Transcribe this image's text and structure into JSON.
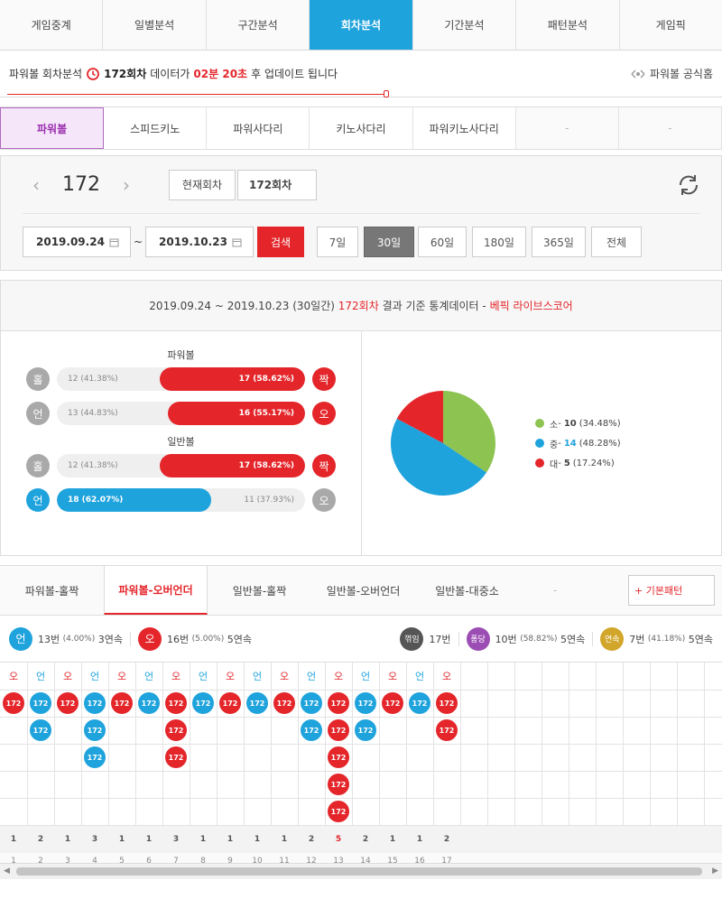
{
  "top_tabs": [
    "게임중계",
    "일별분석",
    "구간분석",
    "회차분석",
    "기간분석",
    "패턴분석",
    "게임픽"
  ],
  "info": {
    "prefix": "파워볼 회차분석",
    "round": "172회차",
    "mid": "데이터가",
    "countdown": "02분 20초",
    "suffix": "후 업데이트 됩니다",
    "official": "파워볼 공식홈"
  },
  "game_tabs": [
    "파워볼",
    "스피드키노",
    "파워사다리",
    "키노사다리",
    "파워키노사다리",
    "-",
    "-"
  ],
  "round_panel": {
    "round": "172",
    "current_btn": "현재회차",
    "round_input": "172회차",
    "date_from": "2019.09.24",
    "date_to": "2019.10.23",
    "tilde": "~",
    "search": "검색",
    "periods": [
      "7일",
      "30일",
      "60일",
      "180일",
      "365일",
      "전체"
    ]
  },
  "stats": {
    "head_range": "2019.09.24 ~ 2019.10.23 (30일간)",
    "head_round": "172회차",
    "head_text": "결과 기준 통계데이터 -",
    "head_brand": "베픽 라이브스코어",
    "powerball_title": "파워볼",
    "normal_title": "일반볼",
    "rows": [
      {
        "left_icon": "홀",
        "left_label": "12 (41.38%)",
        "right_label": "17 (58.62%)",
        "right_icon": "짝",
        "fill_side": "right",
        "fill_pct": 58.62
      },
      {
        "left_icon": "언",
        "left_label": "13 (44.83%)",
        "right_label": "16 (55.17%)",
        "right_icon": "오",
        "fill_side": "right",
        "fill_pct": 55.17
      },
      {
        "left_icon": "홀",
        "left_label": "12 (41.38%)",
        "right_label": "17 (58.62%)",
        "right_icon": "짝",
        "fill_side": "right",
        "fill_pct": 58.62
      },
      {
        "left_icon": "언",
        "left_label": "18 (62.07%)",
        "right_label": "11 (37.93%)",
        "right_icon": "오",
        "fill_side": "left",
        "fill_pct": 62.07
      }
    ],
    "pie": [
      {
        "name": "소",
        "count": "10",
        "pct": "(34.48%)",
        "value": 34.48,
        "color": "#8dc350"
      },
      {
        "name": "중",
        "count": "14",
        "pct": "(48.28%)",
        "value": 48.28,
        "color": "#1fa3dc"
      },
      {
        "name": "대",
        "count": "5",
        "pct": "(17.24%)",
        "value": 17.24,
        "color": "#e4262b"
      }
    ]
  },
  "pattern_tabs": [
    "파워볼-홀짝",
    "파워볼-오버언더",
    "일반볼-홀짝",
    "일반볼-오버언더",
    "일반볼-대중소",
    "-"
  ],
  "basic_pattern_btn": "+ 기본패턴",
  "summary": {
    "under_icon": "언",
    "under_count": "13번",
    "under_pct": "(4.00%)",
    "under_streak": "3연속",
    "over_icon": "오",
    "over_count": "16번",
    "over_pct": "(5.00%)",
    "over_streak": "5연속",
    "break_icon": "꺾임",
    "break_count": "17번",
    "pong_icon": "퐁당",
    "pong_count": "10번",
    "pong_pct": "(58.82%)",
    "pong_streak": "5연속",
    "streak_icon": "연속",
    "streak_count": "7번",
    "streak_pct": "(41.18%)",
    "streak_streak": "5연속"
  },
  "grid": {
    "ball_label": "172",
    "columns": [
      {
        "head": "오",
        "type": "o",
        "count": 1,
        "total": "1",
        "idx": "1"
      },
      {
        "head": "언",
        "type": "u",
        "count": 2,
        "total": "2",
        "idx": "2"
      },
      {
        "head": "오",
        "type": "o",
        "count": 1,
        "total": "1",
        "idx": "3"
      },
      {
        "head": "언",
        "type": "u",
        "count": 3,
        "total": "3",
        "idx": "4"
      },
      {
        "head": "오",
        "type": "o",
        "count": 1,
        "total": "1",
        "idx": "5"
      },
      {
        "head": "언",
        "type": "u",
        "count": 1,
        "total": "1",
        "idx": "6"
      },
      {
        "head": "오",
        "type": "o",
        "count": 3,
        "total": "3",
        "idx": "7"
      },
      {
        "head": "언",
        "type": "u",
        "count": 1,
        "total": "1",
        "idx": "8"
      },
      {
        "head": "오",
        "type": "o",
        "count": 1,
        "total": "1",
        "idx": "9"
      },
      {
        "head": "언",
        "type": "u",
        "count": 1,
        "total": "1",
        "idx": "10"
      },
      {
        "head": "오",
        "type": "o",
        "count": 1,
        "total": "1",
        "idx": "11"
      },
      {
        "head": "언",
        "type": "u",
        "count": 2,
        "total": "2",
        "idx": "12"
      },
      {
        "head": "오",
        "type": "o",
        "count": 5,
        "total": "5",
        "idx": "13"
      },
      {
        "head": "언",
        "type": "u",
        "count": 2,
        "total": "2",
        "idx": "14"
      },
      {
        "head": "오",
        "type": "o",
        "count": 1,
        "total": "1",
        "idx": "15"
      },
      {
        "head": "언",
        "type": "u",
        "count": 1,
        "total": "1",
        "idx": "16"
      },
      {
        "head": "오",
        "type": "o",
        "count": 2,
        "total": "2",
        "idx": "17"
      }
    ]
  }
}
